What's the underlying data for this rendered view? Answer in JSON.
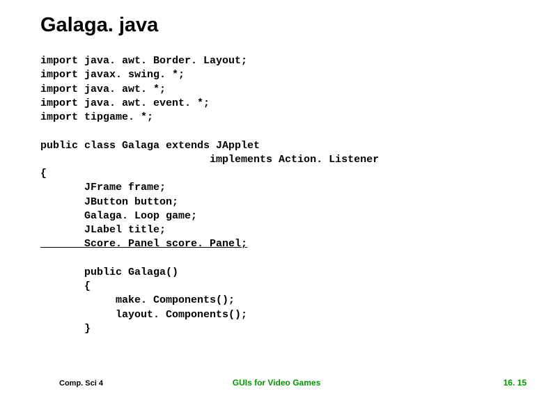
{
  "title": "Galaga. java",
  "imports": [
    "import java. awt. Border. Layout;",
    "import javax. swing. *;",
    "import java. awt. *;",
    "import java. awt. event. *;",
    "import tipgame. *;"
  ],
  "class_decl_line1": "public class Galaga extends JApplet ",
  "class_decl_line2": "                           implements Action. Listener",
  "brace_open": "{",
  "fields": [
    "       JFrame frame;",
    "       JButton button;",
    "       Galaga. Loop game;",
    "       JLabel title;"
  ],
  "field_underlined": "       Score. Panel score. Panel;",
  "ctor_header": "       public Galaga()",
  "ctor_open": "       {",
  "ctor_body": [
    "            make. Components();",
    "            layout. Components();"
  ],
  "ctor_close": "       }",
  "footer": {
    "left": "Comp. Sci 4",
    "center": "GUIs for Video Games",
    "right": "16. 15"
  }
}
